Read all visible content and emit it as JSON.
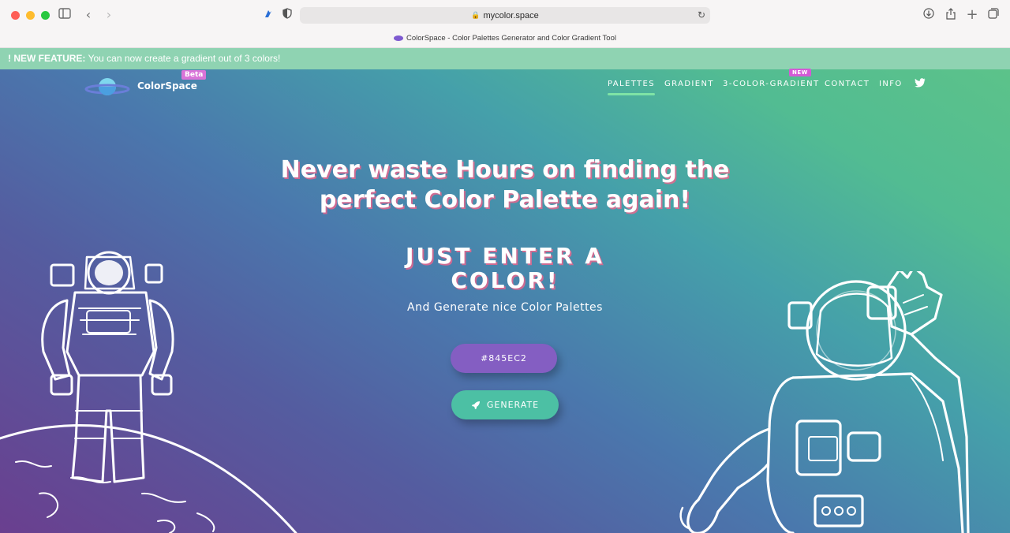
{
  "browser": {
    "url": "mycolor.space",
    "tab_title": "ColorSpace - Color Palettes Generator and Color Gradient Tool"
  },
  "banner": {
    "label": "! NEW FEATURE:",
    "text": "You can now create a gradient out of 3 colors!"
  },
  "header": {
    "brand": "ColorSpace",
    "beta_badge": "Beta",
    "nav": [
      "PALETTES",
      "GRADIENT",
      "3-COLOR-GRADIENT",
      "CONTACT",
      "INFO"
    ],
    "active_nav": "PALETTES",
    "new_badge": "NEW",
    "twitter_icon": "twitter-icon"
  },
  "hero": {
    "headline_line1": "Never waste Hours on finding the",
    "headline_line2": "perfect Color Palette again!",
    "sub_line1": "JUST ENTER A",
    "sub_line2": "COLOR!",
    "sub_caption": "And Generate nice Color Palettes",
    "color_input_value": "#845EC2",
    "generate_label": "GENERATE"
  },
  "colors": {
    "input_bg": "#845ec2",
    "generate_bg": "#4cc0a4",
    "active_underline": "#7ee3a6",
    "badge_pink": "#d45ad6"
  }
}
